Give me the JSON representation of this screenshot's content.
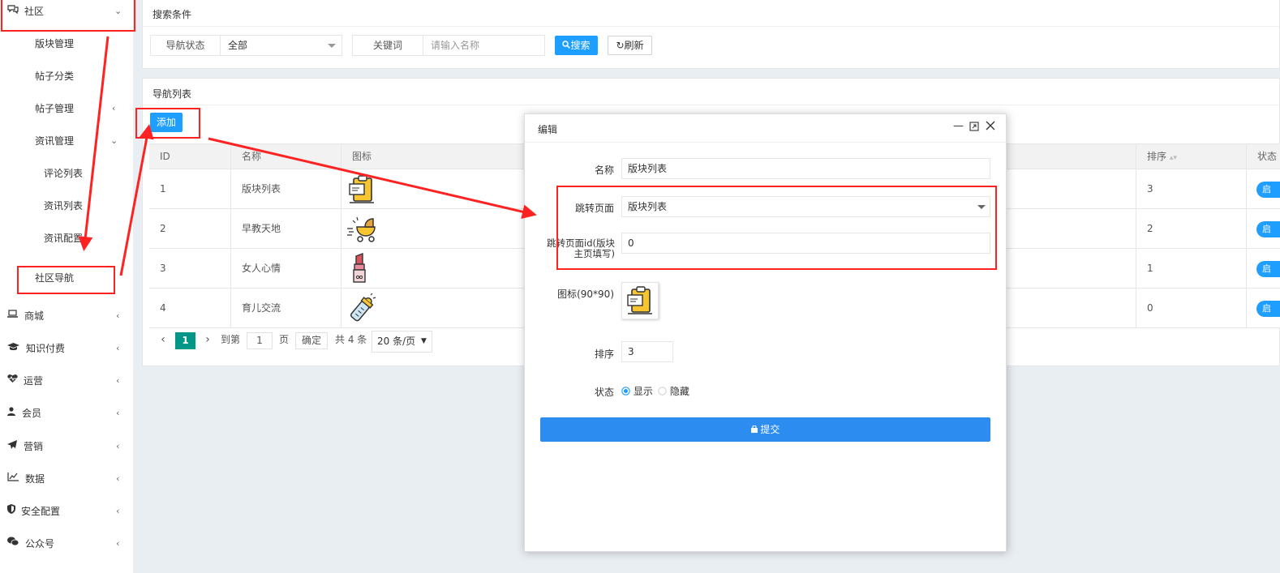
{
  "sidebar": {
    "community": "社区",
    "sub_items": [
      "版块管理",
      "帖子分类",
      "帖子管理",
      "资讯管理",
      "评论列表",
      "资讯列表",
      "资讯配置",
      "社区导航"
    ],
    "items": [
      {
        "label": "商城",
        "icon": "laptop-icon"
      },
      {
        "label": "知识付费",
        "icon": "graduation-cap-icon"
      },
      {
        "label": "运营",
        "icon": "heartbeat-icon"
      },
      {
        "label": "会员",
        "icon": "user-icon"
      },
      {
        "label": "营销",
        "icon": "paper-plane-icon"
      },
      {
        "label": "数据",
        "icon": "line-chart-icon"
      },
      {
        "label": "安全配置",
        "icon": "shield-icon"
      },
      {
        "label": "公众号",
        "icon": "wechat-icon"
      }
    ]
  },
  "search": {
    "title": "搜索条件",
    "status_label": "导航状态",
    "status_value": "全部",
    "keyword_label": "关键词",
    "keyword_placeholder": "请输入名称",
    "search_btn": "搜索",
    "refresh_btn": "刷新"
  },
  "list": {
    "title": "导航列表",
    "add_btn": "添加",
    "headers": {
      "id": "ID",
      "name": "名称",
      "icon": "图标",
      "sort": "排序",
      "status": "状态"
    },
    "rows": [
      {
        "id": "1",
        "name": "版块列表",
        "sort": "3",
        "status": "启"
      },
      {
        "id": "2",
        "name": "早教天地",
        "sort": "2",
        "status": "启"
      },
      {
        "id": "3",
        "name": "女人心情",
        "sort": "1",
        "status": "启"
      },
      {
        "id": "4",
        "name": "育儿交流",
        "sort": "0",
        "status": "启"
      }
    ],
    "pager": {
      "current": "1",
      "goto": "到第",
      "page_value": "1",
      "page_unit": "页",
      "confirm": "确定",
      "total": "共 4 条",
      "per_page": "20 条/页"
    }
  },
  "modal": {
    "title": "编辑",
    "name_label": "名称",
    "name_value": "版块列表",
    "jump_label": "跳转页面",
    "jump_value": "版块列表",
    "jump_id_label_1": "跳转页面id(版块",
    "jump_id_label_2": "主页填写)",
    "jump_id_value": "0",
    "icon_label": "图标(90*90)",
    "sort_label": "排序",
    "sort_value": "3",
    "status_label": "状态",
    "status_show": "显示",
    "status_hide": "隐藏",
    "submit": "提交"
  },
  "colors": {
    "accent": "#1e9fff",
    "annotation": "#ff2222",
    "pager_active": "#009688"
  }
}
